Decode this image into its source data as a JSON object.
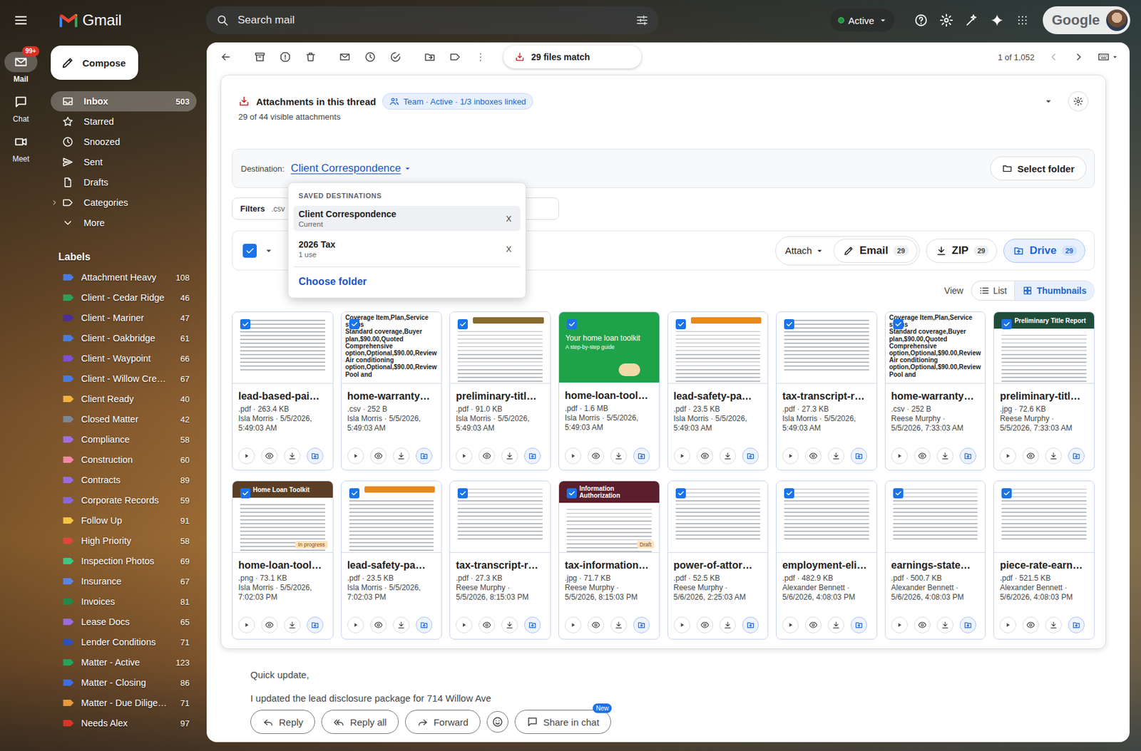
{
  "window": {
    "title": "Gmail"
  },
  "rail": [
    {
      "label": "Mail",
      "selected": true,
      "badge": "99+"
    },
    {
      "label": "Chat",
      "selected": false
    },
    {
      "label": "Meet",
      "selected": false
    }
  ],
  "search": {
    "placeholder": "Search mail"
  },
  "status": {
    "label": "Active",
    "on": true
  },
  "account": {
    "brand": "Google"
  },
  "compose": "Compose",
  "nav": [
    {
      "label": "Inbox",
      "count": "503",
      "selected": true,
      "kind": "link"
    },
    {
      "label": "Starred",
      "selected": false,
      "kind": "link"
    },
    {
      "label": "Snoozed",
      "selected": false,
      "kind": "link"
    },
    {
      "label": "Sent",
      "selected": false,
      "kind": "link"
    },
    {
      "label": "Drafts",
      "selected": false,
      "kind": "link"
    },
    {
      "label": "Categories",
      "selected": false,
      "kind": "group"
    },
    {
      "label": "More",
      "selected": false,
      "kind": "more"
    }
  ],
  "labels_title": "Labels",
  "labels": [
    {
      "name": "Attachment Heavy",
      "count": "108",
      "color": "#4a7be0"
    },
    {
      "name": "Client - Cedar Ridge",
      "count": "46",
      "color": "#2f9e5a"
    },
    {
      "name": "Client - Mariner",
      "count": "47",
      "color": "#4b2e9a"
    },
    {
      "name": "Client - Oakbridge",
      "count": "61",
      "color": "#4a7be0"
    },
    {
      "name": "Client - Waypoint",
      "count": "66",
      "color": "#7b4fd6"
    },
    {
      "name": "Client - Willow Cre…",
      "count": "67",
      "color": "#4a7be0"
    },
    {
      "name": "Client Ready",
      "count": "40",
      "color": "#f0b13d"
    },
    {
      "name": "Closed Matter",
      "count": "42",
      "color": "#7d8794"
    },
    {
      "name": "Compliance",
      "count": "58",
      "color": "#a06fe0"
    },
    {
      "name": "Construction",
      "count": "60",
      "color": "#ef8aa6"
    },
    {
      "name": "Contracts",
      "count": "89",
      "color": "#9b6be0"
    },
    {
      "name": "Corporate Records",
      "count": "59",
      "color": "#8a67d8"
    },
    {
      "name": "Follow Up",
      "count": "91",
      "color": "#f4c542"
    },
    {
      "name": "High Priority",
      "count": "58",
      "color": "#e0463d"
    },
    {
      "name": "Inspection Photos",
      "count": "69",
      "color": "#3cc985"
    },
    {
      "name": "Insurance",
      "count": "67",
      "color": "#5a86e6"
    },
    {
      "name": "Invoices",
      "count": "81",
      "color": "#23884a"
    },
    {
      "name": "Lease Docs",
      "count": "65",
      "color": "#9b6be0"
    },
    {
      "name": "Lender Conditions",
      "count": "71",
      "color": "#2f4fb8"
    },
    {
      "name": "Matter - Active",
      "count": "123",
      "color": "#23a45a"
    },
    {
      "name": "Matter - Closing",
      "count": "86",
      "color": "#3d6fe0"
    },
    {
      "name": "Matter - Due Dilige…",
      "count": "71",
      "color": "#e89a3c"
    },
    {
      "name": "Needs Alex",
      "count": "97",
      "color": "#d9342b"
    }
  ],
  "toolbar": {
    "match": "29 files match",
    "pager": "1 of 1,052"
  },
  "attachments": {
    "title": "Attachments in this thread",
    "team_chip": "Team · Active · 1/3 inboxes linked",
    "summary": "29 of 44 visible attachments",
    "destination_label": "Destination:",
    "destination": "Client Correspondence",
    "select_folder": "Select folder",
    "filters_label": "Filters",
    "filter": ".csv",
    "select_all": true,
    "actions": [
      {
        "label": "Attach",
        "kind": "menu"
      },
      {
        "label": "Email",
        "count": "29",
        "kind": "email"
      },
      {
        "label": "ZIP",
        "count": "29",
        "kind": "zip"
      },
      {
        "label": "Drive",
        "count": "29",
        "kind": "drive"
      }
    ],
    "view_label": "View",
    "views": [
      {
        "label": "List",
        "selected": false
      },
      {
        "label": "Thumbnails",
        "selected": true
      }
    ],
    "files": [
      {
        "name": "lead-based-pai…",
        "meta": ".pdf · 263.4 KB",
        "byline": [
          "Isla Morris · 5/5/2026,",
          "5:49:03 AM"
        ],
        "checked": true,
        "thumb": {
          "kind": "doc"
        }
      },
      {
        "name": "home-warranty…",
        "meta": ".csv · 252 B",
        "byline": [
          "Isla Morris · 5/5/2026,",
          "5:49:03 AM"
        ],
        "checked": true,
        "thumb": {
          "kind": "csv",
          "text": "Coverage Item,Plan,Service status\nStandard coverage,Buyer plan,$90.00,Quoted\nComprehensive option,Optional,$90.00,Review\nAir conditioning option,Optional,$90.00,Review\nPool and"
        }
      },
      {
        "name": "preliminary-titl…",
        "meta": ".pdf · 91.0 KB",
        "byline": [
          "Isla Morris · 5/5/2026,",
          "5:49:03 AM"
        ],
        "checked": true,
        "thumb": {
          "kind": "doc",
          "color": "#8a6b2e"
        }
      },
      {
        "name": "home-loan-tool…",
        "meta": ".pdf · 1.6 MB",
        "byline": [
          "Isla Morris · 5/5/2026,",
          "5:49:03 AM"
        ],
        "checked": true,
        "thumb": {
          "kind": "banner",
          "text": "Your home loan toolkit",
          "sub": "A step-by-step guide",
          "color": "#1ea34a"
        }
      },
      {
        "name": "lead-safety-pa…",
        "meta": ".pdf · 23.5 KB",
        "byline": [
          "Isla Morris · 5/5/2026,",
          "5:49:03 AM"
        ],
        "checked": true,
        "thumb": {
          "kind": "doc",
          "color": "#e8891d"
        }
      },
      {
        "name": "tax-transcript-r…",
        "meta": ".pdf · 27.3 KB",
        "byline": [
          "Isla Morris · 5/5/2026,",
          "5:49:03 AM"
        ],
        "checked": true,
        "thumb": {
          "kind": "doc"
        }
      },
      {
        "name": "home-warranty…",
        "meta": ".csv · 252 B",
        "byline": [
          "Reese Murphy ·",
          "5/5/2026, 7:33:03 AM"
        ],
        "checked": true,
        "thumb": {
          "kind": "csv",
          "text": "Coverage Item,Plan,Service status\nStandard coverage,Buyer plan,$90.00,Quoted\nComprehensive option,Optional,$90.00,Review\nAir conditioning option,Optional,$90.00,Review\nPool and"
        }
      },
      {
        "name": "preliminary-titl…",
        "meta": ".jpg · 72.6 KB",
        "byline": [
          "Reese Murphy ·",
          "5/5/2026, 7:33:03 AM"
        ],
        "checked": true,
        "thumb": {
          "kind": "header",
          "text": "Preliminary Title Report",
          "color": "#1f4d3a"
        }
      },
      {
        "name": "home-loan-tool…",
        "meta": ".png · 73.1 KB",
        "byline": [
          "Isla Morris · 5/5/2026,",
          "7:02:03 PM"
        ],
        "checked": true,
        "thumb": {
          "kind": "header",
          "text": "Home Loan Toolkit",
          "tag": "In progress",
          "color": "#5a3f25"
        }
      },
      {
        "name": "lead-safety-pa…",
        "meta": ".pdf · 23.5 KB",
        "byline": [
          "Isla Morris · 5/5/2026,",
          "7:02:03 PM"
        ],
        "checked": true,
        "thumb": {
          "kind": "doc",
          "color": "#e8891d"
        }
      },
      {
        "name": "tax-transcript-r…",
        "meta": ".pdf · 27.3 KB",
        "byline": [
          "Reese Murphy ·",
          "5/5/2026, 8:15:03 PM"
        ],
        "checked": true,
        "thumb": {
          "kind": "doc"
        }
      },
      {
        "name": "tax-information…",
        "meta": ".jpg · 71.7 KB",
        "byline": [
          "Reese Murphy ·",
          "5/5/2026, 8:15:03 PM"
        ],
        "checked": true,
        "thumb": {
          "kind": "header",
          "text": "Information Authorization",
          "tag": "Draft",
          "color": "#5a1f2b"
        }
      },
      {
        "name": "power-of-attor…",
        "meta": ".pdf · 52.5 KB",
        "byline": [
          "Reese Murphy ·",
          "5/6/2026, 2:25:03 AM"
        ],
        "checked": true,
        "thumb": {
          "kind": "doc"
        }
      },
      {
        "name": "employment-eli…",
        "meta": ".pdf · 482.9 KB",
        "byline": [
          "Alexander Bennett ·",
          "5/6/2026, 4:08:03 PM"
        ],
        "checked": true,
        "thumb": {
          "kind": "doc"
        }
      },
      {
        "name": "earnings-state…",
        "meta": ".pdf · 500.7 KB",
        "byline": [
          "Alexander Bennett ·",
          "5/6/2026, 4:08:03 PM"
        ],
        "checked": true,
        "thumb": {
          "kind": "doc"
        }
      },
      {
        "name": "piece-rate-earn…",
        "meta": ".pdf · 521.5 KB",
        "byline": [
          "Alexander Bennett ·",
          "5/6/2026, 4:08:03 PM"
        ],
        "checked": true,
        "thumb": {
          "kind": "doc"
        }
      }
    ]
  },
  "menu": {
    "title": "SAVED DESTINATIONS",
    "items": [
      {
        "name": "Client Correspondence",
        "detail": "Current",
        "selected": true,
        "remove": "X"
      },
      {
        "name": "2026 Tax",
        "detail": "1 use",
        "selected": false,
        "remove": "X"
      }
    ],
    "choose": "Choose folder"
  },
  "message": {
    "lines": [
      "Quick update,",
      "I updated the lead disclosure package for 714 Willow Ave"
    ]
  },
  "reply_bar": [
    {
      "label": "Reply",
      "kind": "reply"
    },
    {
      "label": "Reply all",
      "kind": "reply-all"
    },
    {
      "label": "Forward",
      "kind": "forward"
    },
    {
      "kind": "emoji"
    },
    {
      "label": "Share in chat",
      "kind": "chat",
      "badge": "New"
    }
  ]
}
